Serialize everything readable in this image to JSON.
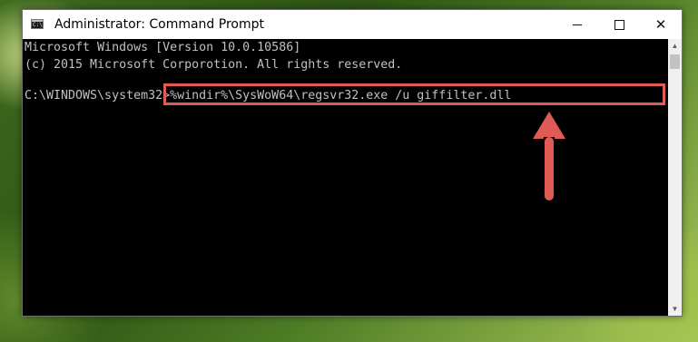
{
  "window": {
    "title": "Administrator: Command Prompt",
    "icon": "cmd-icon",
    "icon_text": "C:\\",
    "controls": {
      "minimize_icon": "minimize-icon",
      "maximize_icon": "maximize-icon",
      "close_icon": "close-icon",
      "close_glyph": "✕"
    }
  },
  "console": {
    "lines": [
      "Microsoft Windows [Version 10.0.10586]",
      "(c) 2015 Microsoft Corporotion. All rights reserved."
    ],
    "prompt": "C:\\WINDOWS\\system32>",
    "command": "%windir%\\SysWoW64\\regsvr32.exe /u giffilter.dll",
    "text_color": "#c0c0c0",
    "background_color": "#000000"
  },
  "annotation": {
    "highlight_color": "#e15b56",
    "arrow_icon": "up-arrow-icon",
    "arrow_color": "#e15b56"
  },
  "scrollbar": {
    "up_glyph": "▲",
    "down_glyph": "▼"
  }
}
